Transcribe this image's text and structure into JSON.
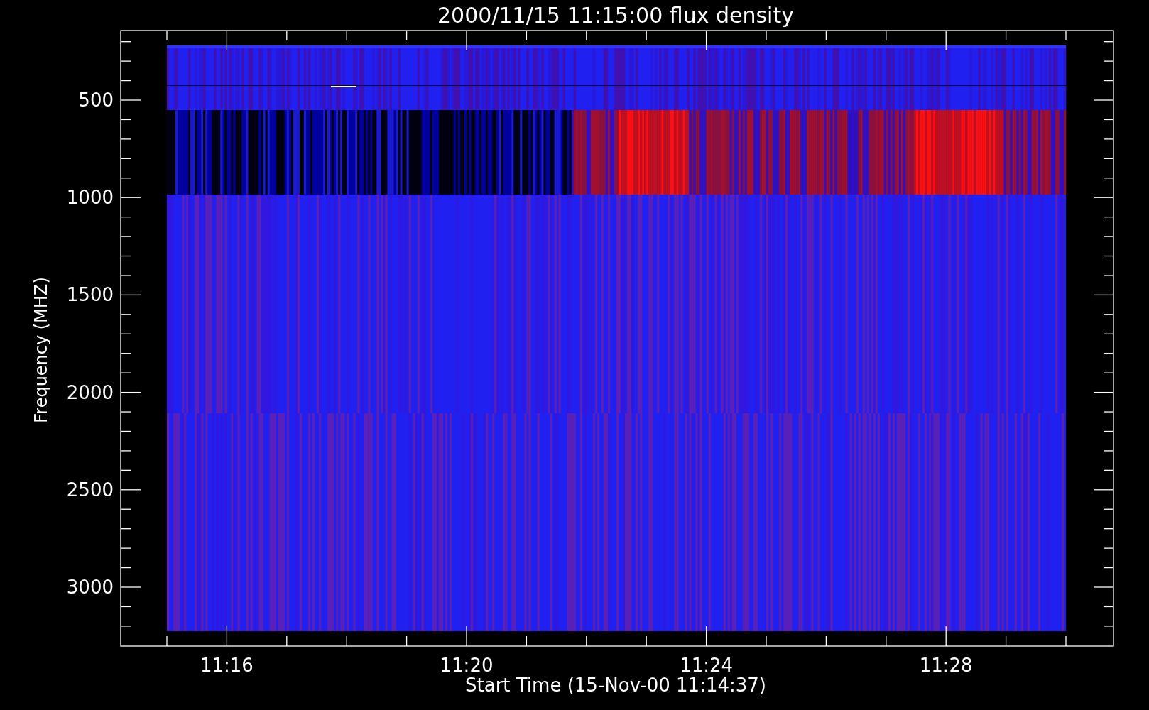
{
  "plot": {
    "title": "2000/11/15 11:15:00 flux density",
    "ylabel": "Frequency (MHZ)",
    "xlabel": "Start Time (15-Nov-00 11:14:37)",
    "yticks": [
      "500",
      "1000",
      "1500",
      "2000",
      "2500",
      "3000"
    ],
    "xticks": [
      "11:16",
      "11:20",
      "11:24",
      "11:28"
    ]
  }
}
